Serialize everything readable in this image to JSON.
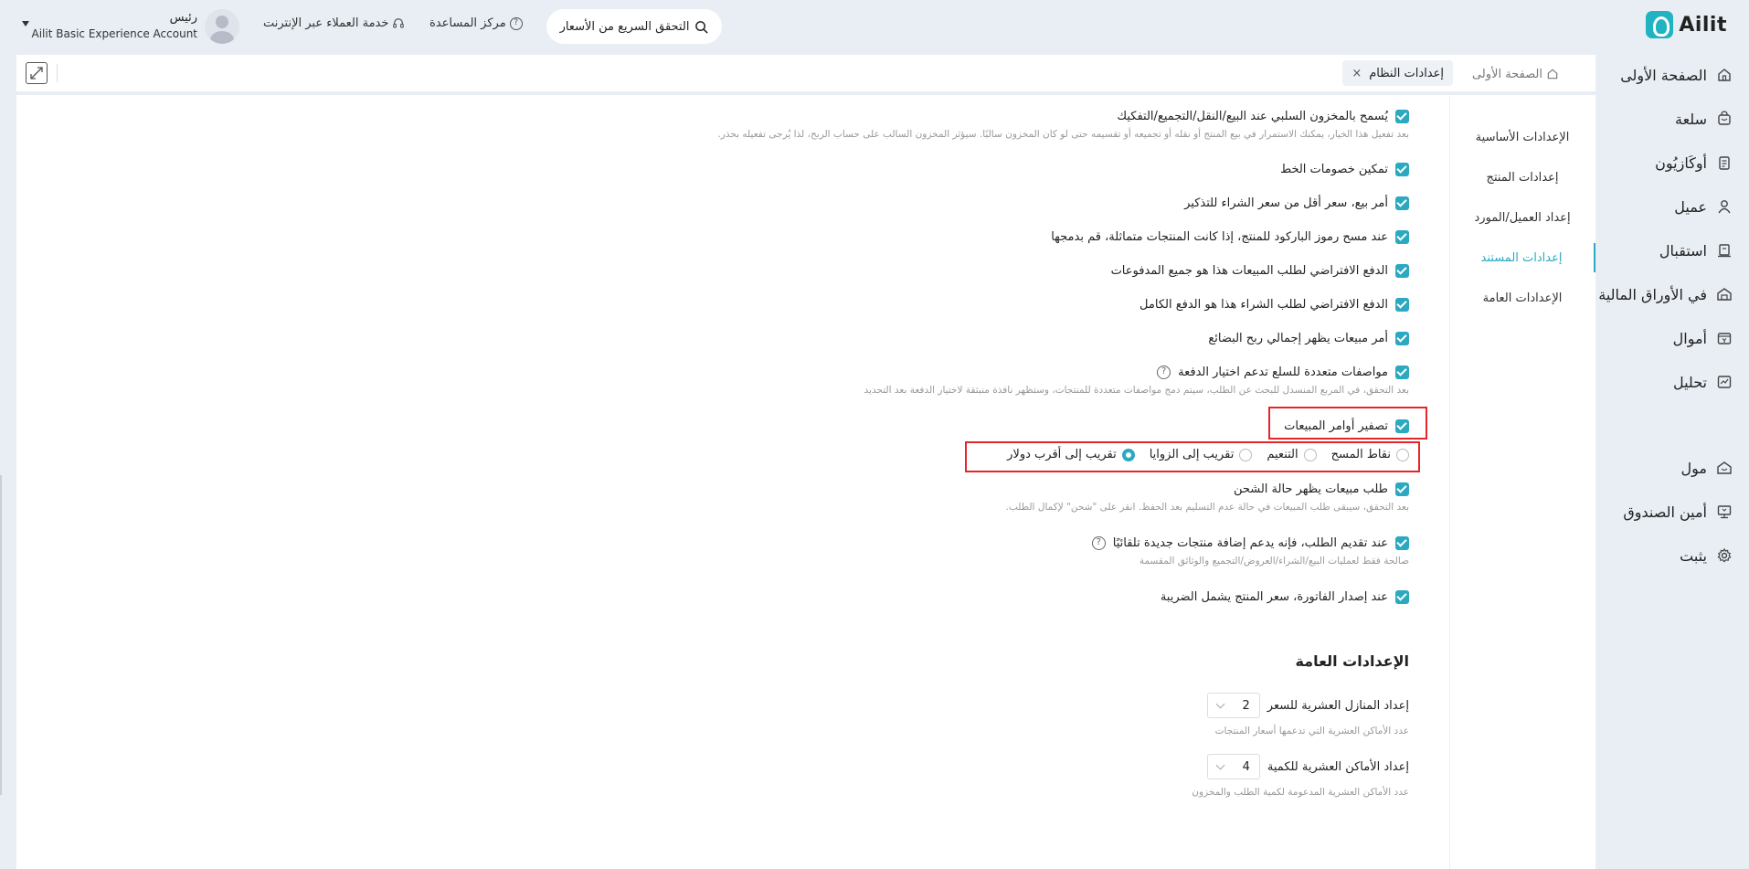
{
  "app": {
    "logo_text": "Ailit",
    "accent_color": "#2aa9c0",
    "highlight_color": "#e5252a"
  },
  "header": {
    "quick_search_label": "التحقق السريع من الأسعار",
    "help_center_label": "مركز المساعدة",
    "customer_service_label": "خدمة العملاء عبر الإنترنت",
    "account_role": "رئيس",
    "account_name": "Ailit Basic Experience Account"
  },
  "sidebar": {
    "items": [
      {
        "label": "الصفحة الأولى",
        "icon": "home-icon"
      },
      {
        "label": "سلعة",
        "icon": "product-icon"
      },
      {
        "label": "أوكَازيُون",
        "icon": "document-icon"
      },
      {
        "label": "عميل",
        "icon": "user-icon"
      },
      {
        "label": "استقبال",
        "icon": "receive-icon"
      },
      {
        "label": "في الأوراق المالية",
        "icon": "stock-icon"
      },
      {
        "label": "أموال",
        "icon": "money-icon"
      },
      {
        "label": "تحليل",
        "icon": "chart-icon"
      },
      {
        "label": "مول",
        "icon": "mall-icon"
      },
      {
        "label": "أمين الصندوق",
        "icon": "cashier-icon"
      },
      {
        "label": "يثبت",
        "icon": "gear-icon"
      }
    ]
  },
  "tabs": {
    "home_label": "الصفحة الأولى",
    "active_label": "إعدادات النظام",
    "close_symbol": "×"
  },
  "subnav": {
    "items": [
      {
        "label": "الإعدادات الأساسية",
        "active": false
      },
      {
        "label": "إعدادات المنتج",
        "active": false
      },
      {
        "label": "إعداد العميل/المورد",
        "active": false
      },
      {
        "label": "إعدادات المستند",
        "active": true
      },
      {
        "label": "الإعدادات العامة",
        "active": false
      }
    ]
  },
  "document_settings": {
    "options": [
      {
        "label": "يُسمح بالمخزون السلبي عند البيع/النقل/التجميع/التفكيك",
        "checked": true,
        "desc": "بعد تفعيل هذا الخيار، يمكنك الاستمرار في بيع المنتج أو نقله أو تجميعه أو تقسيمه حتى لو كان المخزون سالبًا. سيؤثر المخزون السالب على حساب الربح، لذا يُرجى تفعيله بحذر."
      },
      {
        "label": "تمكين خصومات الخط",
        "checked": true
      },
      {
        "label": "أمر بيع، سعر أقل من سعر الشراء للتذكير",
        "checked": true
      },
      {
        "label": "عند مسح رموز الباركود للمنتج، إذا كانت المنتجات متماثلة، قم بدمجها",
        "checked": true
      },
      {
        "label": "الدفع الافتراضي لطلب المبيعات هذا هو جميع المدفوعات",
        "checked": true
      },
      {
        "label": "الدفع الافتراضي لطلب الشراء هذا هو الدفع الكامل",
        "checked": true
      },
      {
        "label": "أمر مبيعات يظهر إجمالي ربح البضائع",
        "checked": true
      },
      {
        "label": "مواصفات متعددة للسلع تدعم اختيار الدفعة",
        "checked": true,
        "help": "?",
        "desc": "بعد التحقق، في المربع المنسدل للبحث عن الطلب، سيتم دمج مواصفات متعددة للمنتجات، وستظهر نافذة منبثقة لاختيار الدفعة بعد التحديد"
      },
      {
        "label": "تصفير أوامر المبيعات",
        "checked": true
      },
      {
        "label": "طلب مبيعات يظهر حالة الشحن",
        "checked": true,
        "desc": "بعد التحقق، سيبقى طلب المبيعات في حالة عدم التسليم بعد الحفظ. انقر على \"شحن\" لإكمال الطلب."
      },
      {
        "label": "عند تقديم الطلب، فإنه يدعم إضافة منتجات جديدة تلقائيًا",
        "checked": true,
        "help": "?",
        "desc": "صالحة فقط لعمليات البيع/الشراء/العروض/التجميع والوثائق المقسمة"
      },
      {
        "label": "عند إصدار الفاتورة، سعر المنتج يشمل الضريبة",
        "checked": true
      }
    ],
    "rounding_options": [
      {
        "label": "نقاط المسح",
        "selected": false
      },
      {
        "label": "التنعيم",
        "selected": false
      },
      {
        "label": "تقريب إلى الزوايا",
        "selected": false
      },
      {
        "label": "تقريب إلى أقرب دولار",
        "selected": true
      }
    ]
  },
  "general_settings": {
    "title": "الإعدادات العامة",
    "price_decimals": {
      "label": "إعداد المنازل العشرية للسعر",
      "value": "2",
      "desc": "عدد الأماكن العشرية التي تدعمها أسعار المنتجات"
    },
    "qty_decimals": {
      "label": "إعداد الأماكن العشرية للكمية",
      "value": "4",
      "desc": "عدد الأماكن العشرية المدعومة لكمية الطلب والمخزون"
    }
  }
}
